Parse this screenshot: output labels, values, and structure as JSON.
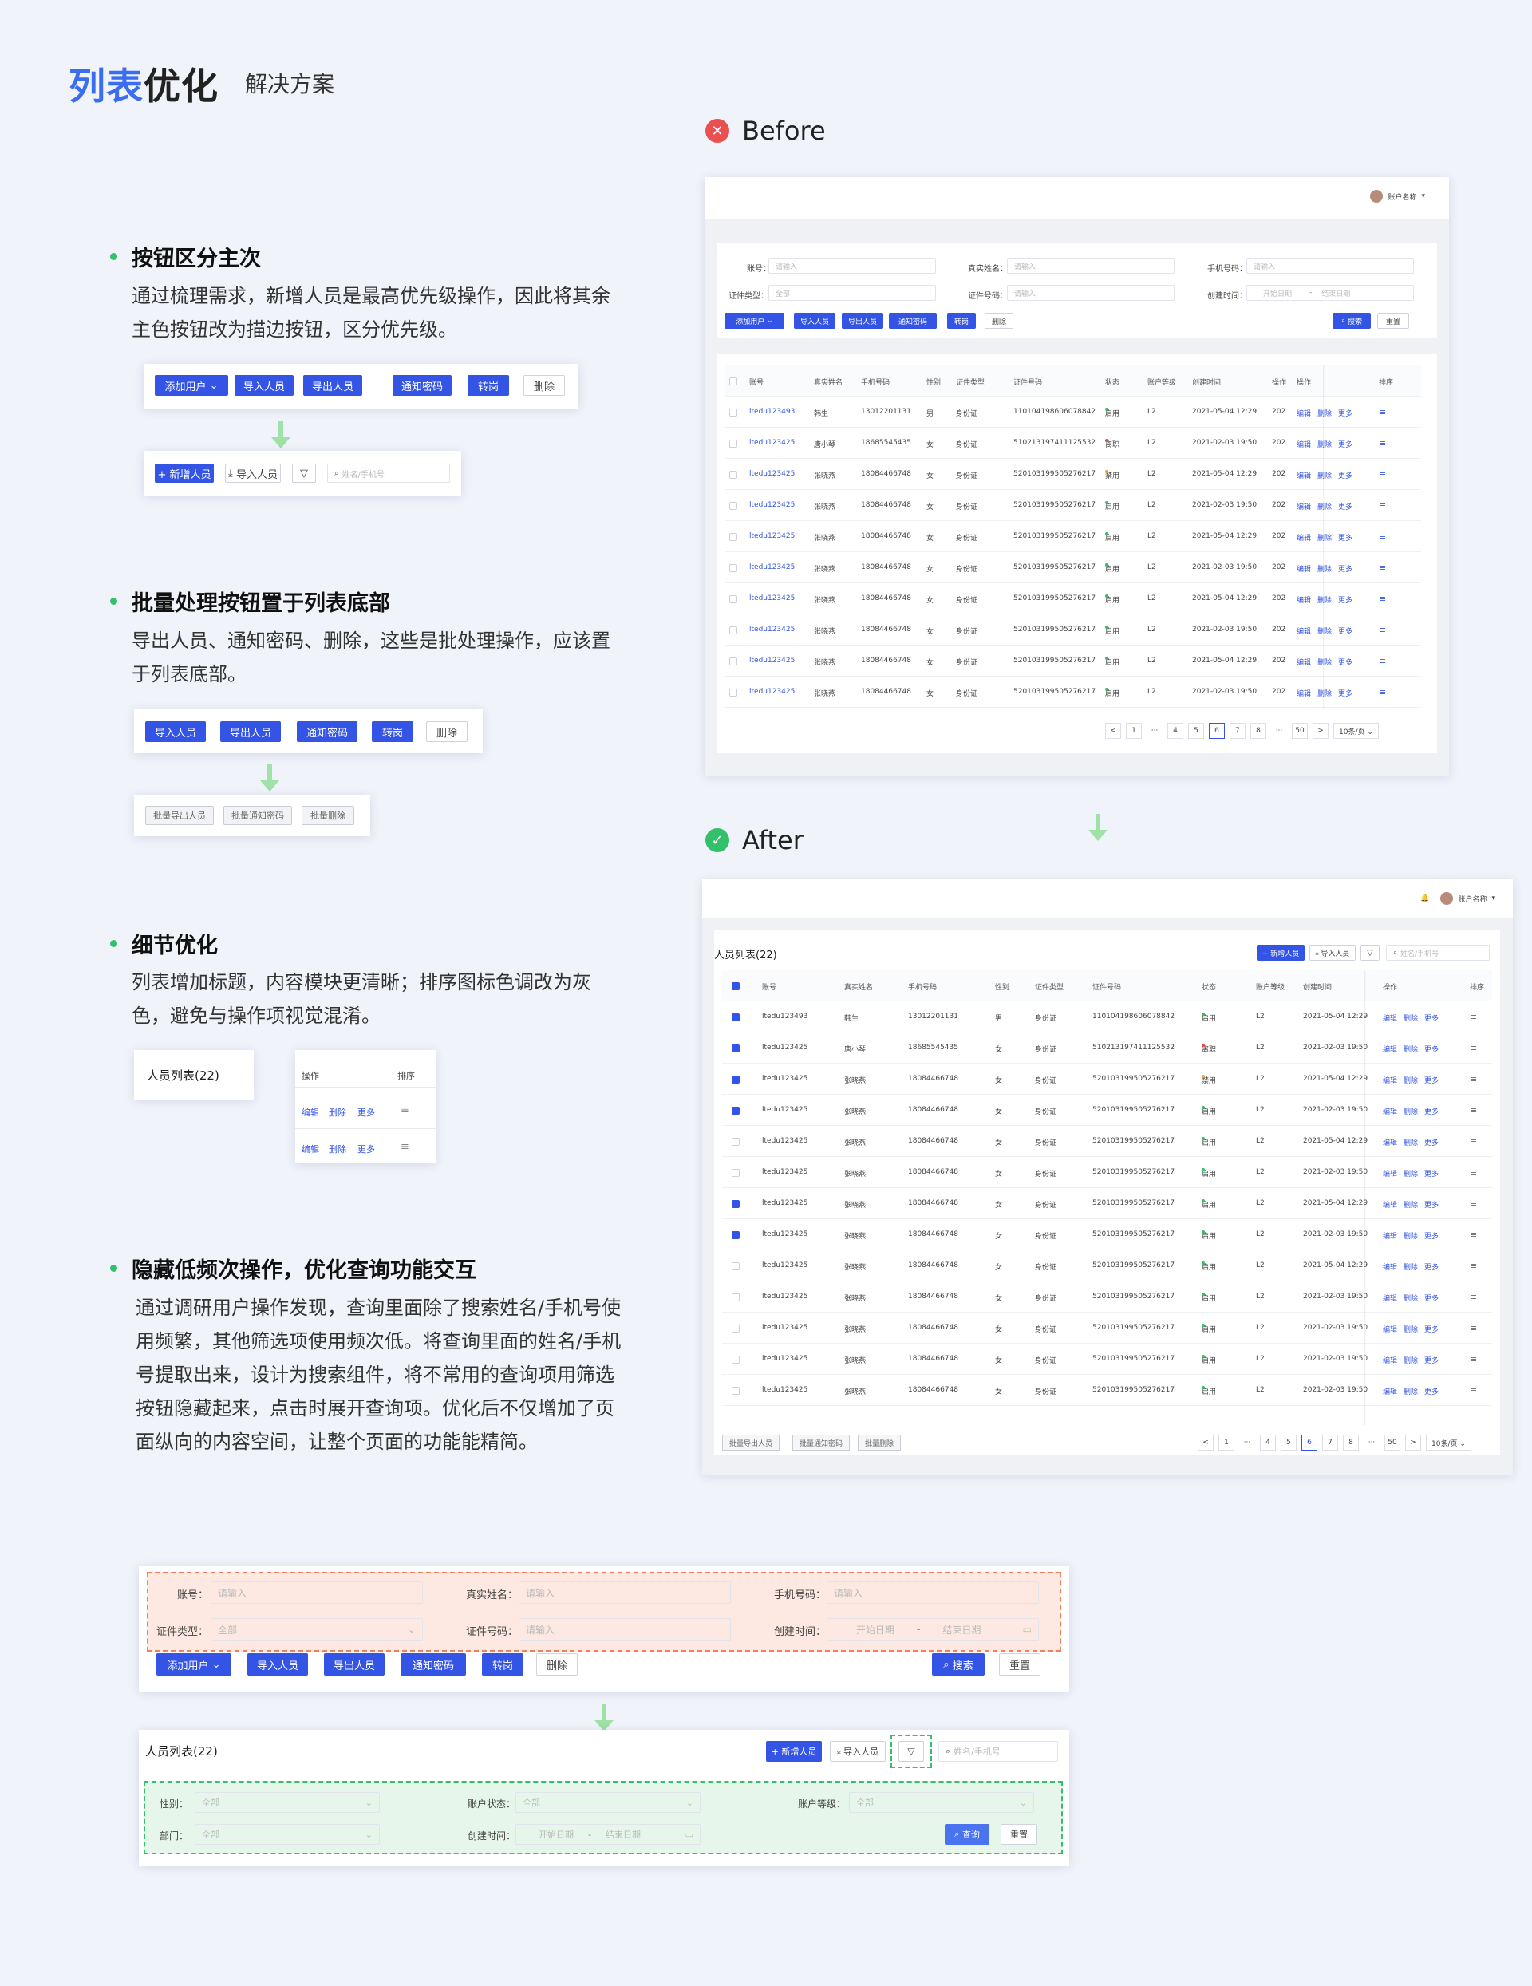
{
  "header": {
    "title_blue": "列表",
    "title_black": "优化",
    "subtitle": "解决方案"
  },
  "sections": [
    {
      "title": "按钮区分主次",
      "text": "通过梳理需求，新增人员是最高优先级操作，因此将其余主色按钮改为描边按钮，区分优先级。"
    },
    {
      "title": "批量处理按钮置于列表底部",
      "text": "导出人员、通知密码、删除，这些是批处理操作，应该置于列表底部。"
    },
    {
      "title": "细节优化",
      "text": "列表增加标题，内容模块更清晰；排序图标色调改为灰色，避免与操作项视觉混淆。"
    },
    {
      "title": "隐藏低频次操作，优化查询功能交互",
      "text": "通过调研用户操作发现，查询里面除了搜索姓名/手机号使用频繁，其他筛选项使用频次低。将查询里面的姓名/手机号提取出来，设计为搜索组件，将不常用的查询项用筛选按钮隐藏起来，点击时展开查询项。优化后不仅增加了页面纵向的内容空间，让整个页面的功能能精简。"
    }
  ],
  "buttons": {
    "add_user": "添加用户",
    "import": "导入人员",
    "export": "导出人员",
    "notify": "通知密码",
    "transfer": "转岗",
    "delete": "删除",
    "new_person": "+ 新增人员",
    "search": "搜索",
    "reset": "重置",
    "query": "查询",
    "batch_export": "批量导出人员",
    "batch_notify": "批量通知密码",
    "batch_delete": "批量删除"
  },
  "search": {
    "placeholder": "姓名/手机号"
  },
  "badges": {
    "before": "Before",
    "after": "After"
  },
  "account": {
    "name": "账户名称"
  },
  "filters": {
    "account": "账号：",
    "real_name": "真实姓名：",
    "phone": "手机号码：",
    "id_type": "证件类型：",
    "id_no": "证件号码：",
    "created": "创建时间：",
    "gender": "性别：",
    "acct_status": "账户状态：",
    "acct_level": "账户等级：",
    "dept": "部门：",
    "ph_input": "请输入",
    "ph_all": "全部",
    "ph_start": "开始日期",
    "ph_end": "结束日期",
    "range_sep": "-"
  },
  "list_title": "人员列表(22)",
  "columns": {
    "account": "账号",
    "name": "真实姓名",
    "phone": "手机号码",
    "gender": "性别",
    "idtype": "证件类型",
    "idno": "证件号码",
    "status": "状态",
    "level": "账户等级",
    "created": "创建时间",
    "op": "操作",
    "op_short": "操作",
    "sort": "排序"
  },
  "row_actions": {
    "edit": "编辑",
    "delete": "删除",
    "more": "更多",
    "sort_icon": "≡"
  },
  "created_trunc": "202",
  "before_rows": [
    {
      "acc": "ltedu123493",
      "name": "韩生",
      "phone": "13012201131",
      "g": "男",
      "t": "身份证",
      "id": "110104198606078842",
      "st": "启用",
      "c": "#33c06a",
      "lv": "L2",
      "time": "2021-05-04 12:29"
    },
    {
      "acc": "ltedu123425",
      "name": "唐小琴",
      "phone": "18685545435",
      "g": "女",
      "t": "身份证",
      "id": "510213197411125532",
      "st": "离职",
      "c": "#e84848",
      "lv": "L2",
      "time": "2021-02-03 19:50"
    },
    {
      "acc": "ltedu123425",
      "name": "张晓燕",
      "phone": "18084466748",
      "g": "女",
      "t": "身份证",
      "id": "520103199505276217",
      "st": "禁用",
      "c": "#f0a030",
      "lv": "L2",
      "time": "2021-05-04 12:29"
    },
    {
      "acc": "ltedu123425",
      "name": "张晓燕",
      "phone": "18084466748",
      "g": "女",
      "t": "身份证",
      "id": "520103199505276217",
      "st": "启用",
      "c": "#33c06a",
      "lv": "L2",
      "time": "2021-02-03 19:50"
    },
    {
      "acc": "ltedu123425",
      "name": "张晓燕",
      "phone": "18084466748",
      "g": "女",
      "t": "身份证",
      "id": "520103199505276217",
      "st": "启用",
      "c": "#33c06a",
      "lv": "L2",
      "time": "2021-05-04 12:29"
    },
    {
      "acc": "ltedu123425",
      "name": "张晓燕",
      "phone": "18084466748",
      "g": "女",
      "t": "身份证",
      "id": "520103199505276217",
      "st": "启用",
      "c": "#33c06a",
      "lv": "L2",
      "time": "2021-02-03 19:50"
    },
    {
      "acc": "ltedu123425",
      "name": "张晓燕",
      "phone": "18084466748",
      "g": "女",
      "t": "身份证",
      "id": "520103199505276217",
      "st": "启用",
      "c": "#33c06a",
      "lv": "L2",
      "time": "2021-05-04 12:29"
    },
    {
      "acc": "ltedu123425",
      "name": "张晓燕",
      "phone": "18084466748",
      "g": "女",
      "t": "身份证",
      "id": "520103199505276217",
      "st": "启用",
      "c": "#33c06a",
      "lv": "L2",
      "time": "2021-02-03 19:50"
    },
    {
      "acc": "ltedu123425",
      "name": "张晓燕",
      "phone": "18084466748",
      "g": "女",
      "t": "身份证",
      "id": "520103199505276217",
      "st": "启用",
      "c": "#33c06a",
      "lv": "L2",
      "time": "2021-05-04 12:29"
    },
    {
      "acc": "ltedu123425",
      "name": "张晓燕",
      "phone": "18084466748",
      "g": "女",
      "t": "身份证",
      "id": "520103199505276217",
      "st": "启用",
      "c": "#33c06a",
      "lv": "L2",
      "time": "2021-02-03 19:50"
    }
  ],
  "after_rows": [
    {
      "chk": true,
      "acc": "ltedu123493",
      "name": "韩生",
      "phone": "13012201131",
      "g": "男",
      "t": "身份证",
      "id": "110104198606078842",
      "st": "启用",
      "c": "#33c06a",
      "lv": "L2",
      "time": "2021-05-04 12:29"
    },
    {
      "chk": true,
      "acc": "ltedu123425",
      "name": "唐小琴",
      "phone": "18685545435",
      "g": "女",
      "t": "身份证",
      "id": "510213197411125532",
      "st": "离职",
      "c": "#e84848",
      "lv": "L2",
      "time": "2021-02-03 19:50"
    },
    {
      "chk": true,
      "acc": "ltedu123425",
      "name": "张晓燕",
      "phone": "18084466748",
      "g": "女",
      "t": "身份证",
      "id": "520103199505276217",
      "st": "禁用",
      "c": "#f0a030",
      "lv": "L2",
      "time": "2021-05-04 12:29"
    },
    {
      "chk": true,
      "acc": "ltedu123425",
      "name": "张晓燕",
      "phone": "18084466748",
      "g": "女",
      "t": "身份证",
      "id": "520103199505276217",
      "st": "启用",
      "c": "#33c06a",
      "lv": "L2",
      "time": "2021-02-03 19:50"
    },
    {
      "chk": false,
      "acc": "ltedu123425",
      "name": "张晓燕",
      "phone": "18084466748",
      "g": "女",
      "t": "身份证",
      "id": "520103199505276217",
      "st": "启用",
      "c": "#33c06a",
      "lv": "L2",
      "time": "2021-05-04 12:29"
    },
    {
      "chk": false,
      "acc": "ltedu123425",
      "name": "张晓燕",
      "phone": "18084466748",
      "g": "女",
      "t": "身份证",
      "id": "520103199505276217",
      "st": "启用",
      "c": "#33c06a",
      "lv": "L2",
      "time": "2021-02-03 19:50"
    },
    {
      "chk": true,
      "acc": "ltedu123425",
      "name": "张晓燕",
      "phone": "18084466748",
      "g": "女",
      "t": "身份证",
      "id": "520103199505276217",
      "st": "启用",
      "c": "#33c06a",
      "lv": "L2",
      "time": "2021-05-04 12:29"
    },
    {
      "chk": true,
      "acc": "ltedu123425",
      "name": "张晓燕",
      "phone": "18084466748",
      "g": "女",
      "t": "身份证",
      "id": "520103199505276217",
      "st": "启用",
      "c": "#33c06a",
      "lv": "L2",
      "time": "2021-02-03 19:50"
    },
    {
      "chk": false,
      "acc": "ltedu123425",
      "name": "张晓燕",
      "phone": "18084466748",
      "g": "女",
      "t": "身份证",
      "id": "520103199505276217",
      "st": "启用",
      "c": "#33c06a",
      "lv": "L2",
      "time": "2021-05-04 12:29"
    },
    {
      "chk": false,
      "acc": "ltedu123425",
      "name": "张晓燕",
      "phone": "18084466748",
      "g": "女",
      "t": "身份证",
      "id": "520103199505276217",
      "st": "启用",
      "c": "#33c06a",
      "lv": "L2",
      "time": "2021-02-03 19:50"
    },
    {
      "chk": false,
      "acc": "ltedu123425",
      "name": "张晓燕",
      "phone": "18084466748",
      "g": "女",
      "t": "身份证",
      "id": "520103199505276217",
      "st": "启用",
      "c": "#33c06a",
      "lv": "L2",
      "time": "2021-02-03 19:50"
    },
    {
      "chk": false,
      "acc": "ltedu123425",
      "name": "张晓燕",
      "phone": "18084466748",
      "g": "女",
      "t": "身份证",
      "id": "520103199505276217",
      "st": "启用",
      "c": "#33c06a",
      "lv": "L2",
      "time": "2021-02-03 19:50"
    },
    {
      "chk": false,
      "acc": "ltedu123425",
      "name": "张晓燕",
      "phone": "18084466748",
      "g": "女",
      "t": "身份证",
      "id": "520103199505276217",
      "st": "启用",
      "c": "#33c06a",
      "lv": "L2",
      "time": "2021-02-03 19:50"
    }
  ],
  "pagination": [
    "<",
    "1",
    "···",
    "4",
    "5",
    "6",
    "7",
    "8",
    "···",
    "50",
    ">"
  ],
  "pagination_active": "6",
  "page_size": "10条/页",
  "colors": {
    "primary": "#3354e4",
    "accent_blue": "#3a6df0",
    "green": "#33c06a",
    "red": "#e84848",
    "orange_area": "#fde9e1",
    "green_area": "#e6f6ea"
  },
  "icons": {
    "error": "error-circle-icon",
    "success": "success-circle-icon",
    "filter": "filter-icon",
    "search": "search-icon",
    "bell": "bell-icon",
    "calendar": "calendar-icon"
  }
}
